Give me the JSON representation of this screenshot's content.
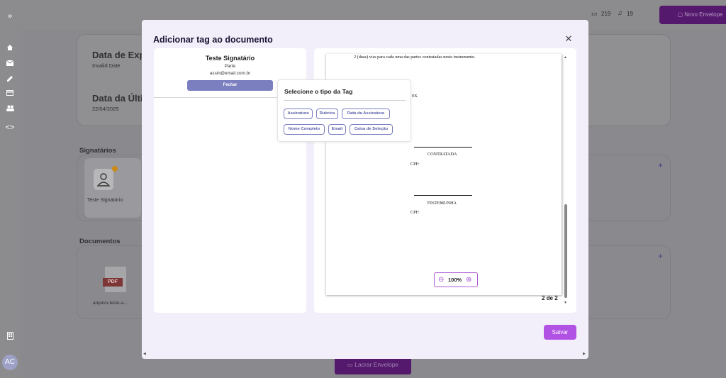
{
  "app": {
    "avatar_initials": "AC",
    "topbar": {
      "folder_count": "219",
      "bell_count": "19",
      "new_envelope_label": "Novo Envelope"
    },
    "sidebar_icons": [
      "home-icon",
      "mail-icon",
      "signature-icon",
      "card-icon",
      "users-icon",
      "code-icon",
      "building-icon"
    ]
  },
  "background": {
    "expiration_label": "Data de Exp",
    "expiration_value": "Invalid Date",
    "last_label": "Data da Últi",
    "last_value": "22/04/2025",
    "signers_heading": "Signatários",
    "signer_card_name": "Teste Signatário",
    "documents_heading": "Documentos",
    "document_file_label": "PDF",
    "document_name": "arquivo-teste-a...",
    "read_envelope_label": "Lacrar Envelope"
  },
  "modal": {
    "title": "Adicionar tag ao documento",
    "close_icon": "✕",
    "signer": {
      "name": "Teste Signatário",
      "role": "Parte",
      "email": "assin@email.com.br",
      "close_button": "Fechar"
    },
    "popover": {
      "title": "Selecione o tipo da Tag",
      "tags": [
        "Assinatura",
        "Rubrica",
        "Data da Assinatura",
        "Nome Completo",
        "Email",
        "Caixa de Seleção"
      ]
    },
    "document": {
      "line_top": "2 (duas) vias para cada uma das partes contratadas neste instrumento.",
      "es_fragment": "ES.",
      "contratada": "CONTRATADA",
      "cpf1": "CPF:",
      "testemunha": "TESTEMUNHA",
      "cpf2": "CPF:",
      "zoom": "100%",
      "page_indicator": "2 de 2"
    },
    "save_button": "Salvar"
  }
}
